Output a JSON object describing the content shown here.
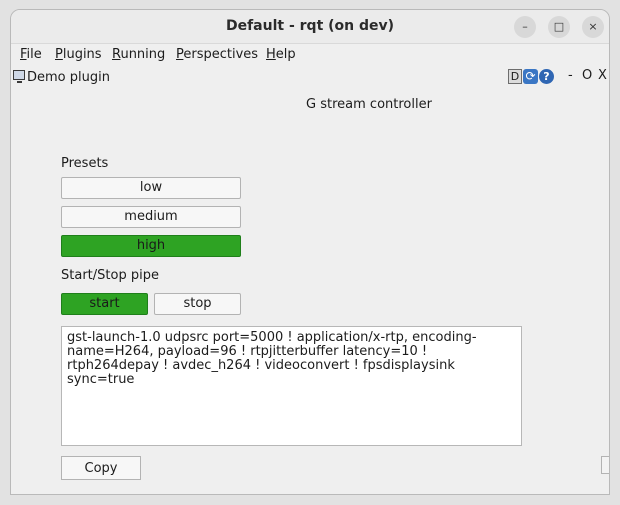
{
  "window": {
    "title": "Default - rqt (on dev)",
    "controls": {
      "minimize": "–",
      "maximize": "□",
      "close": "×"
    }
  },
  "menubar": [
    {
      "first": "F",
      "rest": "ile"
    },
    {
      "first": "P",
      "rest": "lugins"
    },
    {
      "first": "R",
      "rest": "unning"
    },
    {
      "first": "P",
      "rest": "erspectives"
    },
    {
      "first": "H",
      "rest": "elp"
    }
  ],
  "plugin": {
    "title": "Demo plugin",
    "d_label": "D",
    "refresh_glyph": "⟳",
    "help_glyph": "?",
    "dash": "-",
    "o": "O",
    "x": "X"
  },
  "main": {
    "heading": "G stream controller",
    "presets_label": "Presets",
    "presets": [
      {
        "label": "low",
        "active": false
      },
      {
        "label": "medium",
        "active": false
      },
      {
        "label": "high",
        "active": true
      }
    ],
    "pipe_label": "Start/Stop pipe",
    "start_label": "start",
    "stop_label": "stop",
    "pipeline_text": "gst-launch-1.0 udpsrc port=5000 ! application/x-rtp, encoding-name=H264, payload=96 ! rtpjitterbuffer latency=10 ! rtph264depay ! avdec_h264 ! videoconvert ! fpsdisplaysink sync=true",
    "copy_label": "Copy"
  },
  "colors": {
    "active_green": "#2ea323"
  },
  "icons": [
    "monitor-icon",
    "refresh-icon",
    "help-icon"
  ]
}
